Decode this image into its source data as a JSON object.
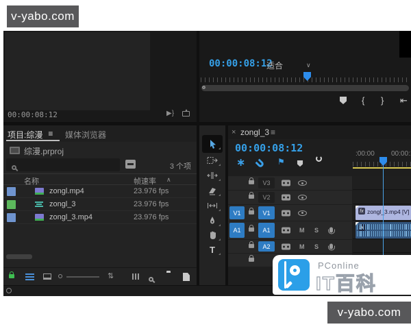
{
  "watermarks": {
    "top": "v-yabo.com",
    "bottom": "v-yabo.com"
  },
  "icons": {
    "menu": "≡",
    "chevron_down": "∨",
    "close": "×",
    "brace_open": "{",
    "brace_close": "}",
    "go_to_in": "⇤",
    "sort_asc": "∧",
    "sort_toggle": "⇅",
    "mute": "M",
    "solo": "S",
    "type_tool": "T",
    "fx_badge": "fx",
    "nest_asterisk": "∗",
    "linked_flag": "⚑",
    "play": "▶"
  },
  "source_monitor": {
    "timecode": "00:00:08:12"
  },
  "program_monitor": {
    "timecode": "00:00:08:12",
    "zoom_select": "适合"
  },
  "project_panel": {
    "tab_active": "项目:综漫",
    "tab_inactive": "媒体浏览器",
    "project_file": "综漫.prproj",
    "item_count": "3 个项",
    "col_name": "名称",
    "col_framerate": "帧速率",
    "items": [
      {
        "name": "zongl.mp4",
        "framerate": "23.976 fps",
        "label_color": "#6f94cf",
        "type": "video"
      },
      {
        "name": "zongl_3",
        "framerate": "23.976 fps",
        "label_color": "#5cb85c",
        "type": "sequence"
      },
      {
        "name": "zongl_3.mp4",
        "framerate": "23.976 fps",
        "label_color": "#6f94cf",
        "type": "video"
      }
    ]
  },
  "tools": [
    "selection-tool",
    "track-select-forward-tool",
    "ripple-edit-tool",
    "razor-tool",
    "slip-tool",
    "pen-tool",
    "hand-tool",
    "type-tool"
  ],
  "timeline": {
    "tab": "zongl_3",
    "timecode": "00:00:08:12",
    "ruler_labels": {
      "start": ":00:00",
      "next": "00:00:1"
    },
    "tracks": [
      {
        "label": "V3"
      },
      {
        "label": "V2"
      },
      {
        "label": "V1",
        "source": "V1"
      },
      {
        "label": "A1",
        "source": "A1"
      },
      {
        "label": "A2"
      },
      {
        "label": ""
      }
    ],
    "video_clip_label": "zongl_3.mp4 [V]"
  },
  "branding": {
    "brand": "PConline",
    "title": "IT百科"
  },
  "colors": {
    "accent_blue": "#35a0e8",
    "target_blue": "#2e7cc3",
    "clip_video": "#aeb6e0",
    "clip_audio": "#33567f",
    "render_bar": "#d9ca52",
    "label_blue": "#6f94cf",
    "label_green": "#5cb85c",
    "watermark_bg": "#58585a",
    "logo_blue": "#2b9fe8"
  }
}
